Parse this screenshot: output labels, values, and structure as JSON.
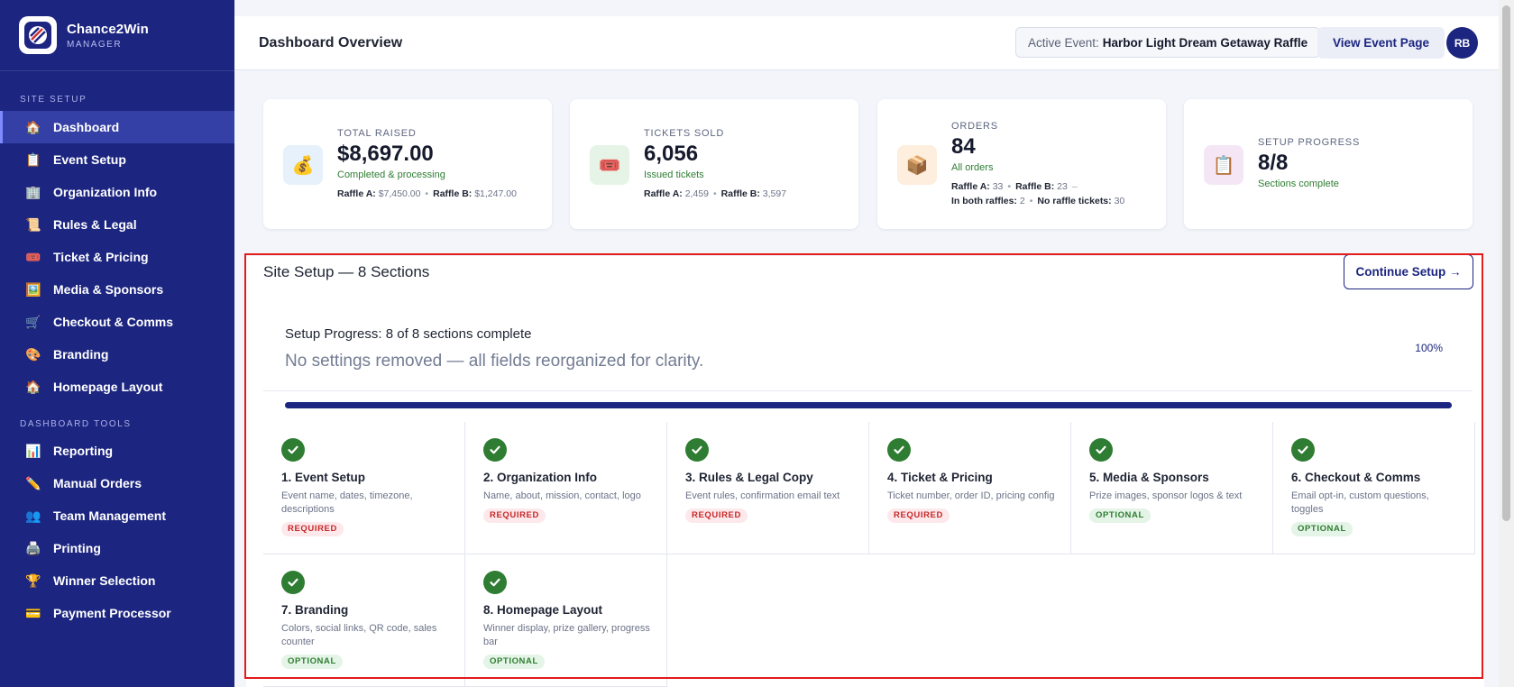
{
  "brand": {
    "name": "Chance2Win",
    "sub": "MANAGER"
  },
  "sidebar": {
    "site_setup_label": "SITE SETUP",
    "site_setup": [
      {
        "label": "Dashboard",
        "icon": "house-icon",
        "active": true
      },
      {
        "label": "Event Setup",
        "icon": "clipboard-icon"
      },
      {
        "label": "Organization Info",
        "icon": "building-icon"
      },
      {
        "label": "Rules & Legal",
        "icon": "scroll-icon"
      },
      {
        "label": "Ticket & Pricing",
        "icon": "ticket-icon"
      },
      {
        "label": "Media & Sponsors",
        "icon": "image-icon"
      },
      {
        "label": "Checkout & Comms",
        "icon": "cart-icon"
      },
      {
        "label": "Branding",
        "icon": "palette-icon"
      },
      {
        "label": "Homepage Layout",
        "icon": "house-icon"
      }
    ],
    "tools_label": "DASHBOARD TOOLS",
    "tools": [
      {
        "label": "Reporting",
        "icon": "bar-chart-icon"
      },
      {
        "label": "Manual Orders",
        "icon": "pen-icon"
      },
      {
        "label": "Team Management",
        "icon": "team-icon"
      },
      {
        "label": "Printing",
        "icon": "printer-icon"
      },
      {
        "label": "Winner Selection",
        "icon": "trophy-icon"
      },
      {
        "label": "Payment Processor",
        "icon": "credit-card-icon"
      }
    ]
  },
  "header": {
    "title": "Dashboard Overview",
    "active_event_label": "Active Event:",
    "active_event_name": "Harbor Light Dream Getaway Raffle",
    "view_event_label": "View Event Page",
    "avatar_initials": "RB"
  },
  "stats": {
    "total_raised": {
      "label": "TOTAL RAISED",
      "value": "$8,697.00",
      "sub": "Completed & processing",
      "raffle_a_label": "Raffle A:",
      "raffle_a": "$7,450.00",
      "raffle_b_label": "Raffle B:",
      "raffle_b": "$1,247.00"
    },
    "tickets_sold": {
      "label": "TICKETS SOLD",
      "value": "6,056",
      "sub": "Issued tickets",
      "raffle_a_label": "Raffle A:",
      "raffle_a": "2,459",
      "raffle_b_label": "Raffle B:",
      "raffle_b": "3,597"
    },
    "orders": {
      "label": "ORDERS",
      "value": "84",
      "sub": "All orders",
      "raffle_a_label": "Raffle A:",
      "raffle_a": "33",
      "raffle_b_label": "Raffle B:",
      "raffle_b": "23",
      "both_label": "In both raffles:",
      "both": "2",
      "none_label": "No raffle tickets:",
      "none": "30"
    },
    "setup_progress": {
      "label": "SETUP PROGRESS",
      "value": "8/8",
      "sub": "Sections complete"
    }
  },
  "setup": {
    "title": "Site Setup — 8 Sections",
    "continue_label": "Continue Setup →",
    "progress_title": "Setup Progress: 8 of 8 sections complete",
    "progress_note": "No settings removed — all fields reorganized for clarity.",
    "progress_pct": "100%",
    "progress_fraction": 1.0,
    "sections": [
      {
        "title": "1. Event Setup",
        "desc": "Event name, dates, timezone, descriptions",
        "badge": "REQUIRED"
      },
      {
        "title": "2. Organization Info",
        "desc": "Name, about, mission, contact, logo",
        "badge": "REQUIRED"
      },
      {
        "title": "3. Rules & Legal Copy",
        "desc": "Event rules, confirmation email text",
        "badge": "REQUIRED"
      },
      {
        "title": "4. Ticket & Pricing",
        "desc": "Ticket number, order ID, pricing config",
        "badge": "REQUIRED"
      },
      {
        "title": "5. Media & Sponsors",
        "desc": "Prize images, sponsor logos & text",
        "badge": "OPTIONAL"
      },
      {
        "title": "6. Checkout & Comms",
        "desc": "Email opt-in, custom questions, toggles",
        "badge": "OPTIONAL"
      },
      {
        "title": "7. Branding",
        "desc": "Colors, social links, QR code, sales counter",
        "badge": "OPTIONAL"
      },
      {
        "title": "8. Homepage Layout",
        "desc": "Winner display, prize gallery, progress bar",
        "badge": "OPTIONAL"
      }
    ]
  },
  "colors": {
    "primary": "#1c2580",
    "success": "#2e7d32",
    "danger": "#c62828",
    "highlight": "#e21b1b"
  }
}
